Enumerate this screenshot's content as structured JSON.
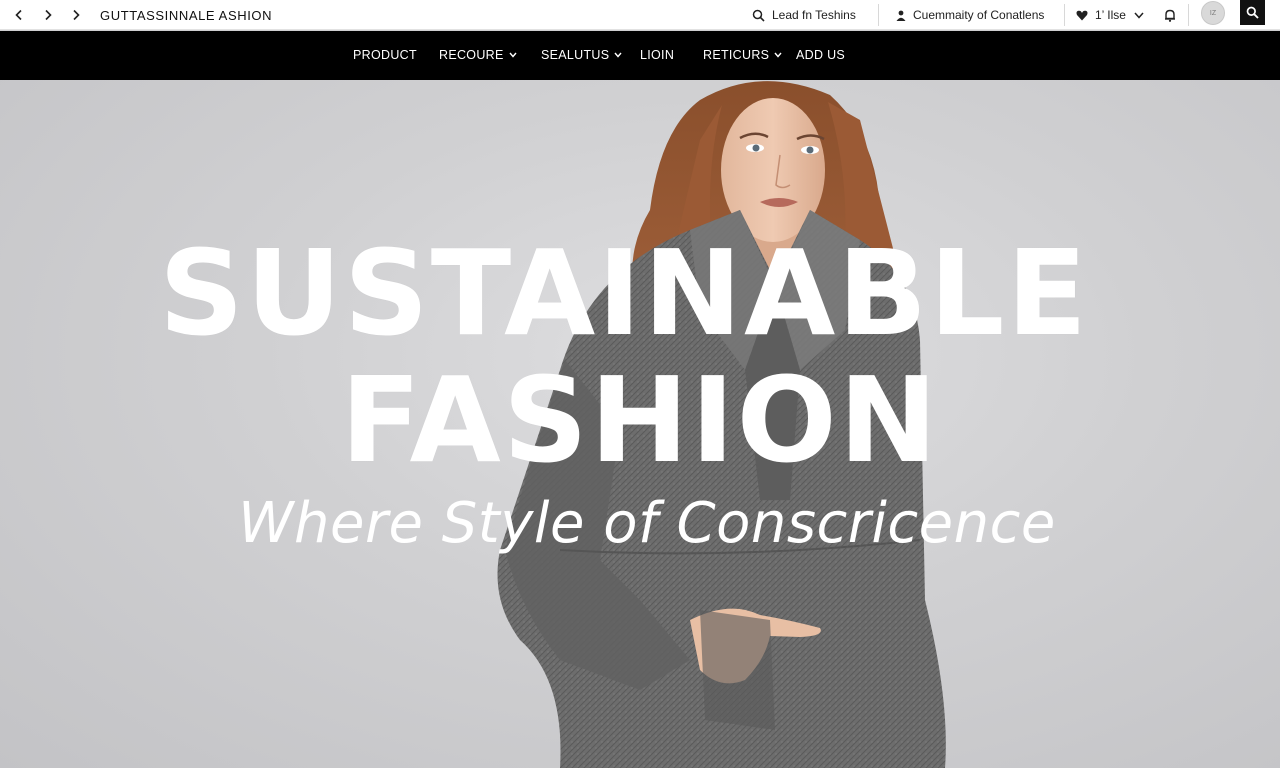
{
  "browser": {
    "site_title": "GUTTASSINNALE ASHION",
    "search_label": "Lead fn Teshins",
    "community_label": "Cuemmaity of Conatlens",
    "like_label": "1’ Ilse",
    "avatar_text": "IZ"
  },
  "nav": {
    "items": [
      {
        "label": "PRODUCT",
        "has_dropdown": false
      },
      {
        "label": "RECOURE",
        "has_dropdown": true
      },
      {
        "label": "SEALUTUS",
        "has_dropdown": true
      },
      {
        "label": "LIOIN",
        "has_dropdown": false
      },
      {
        "label": "RETICURS",
        "has_dropdown": true
      },
      {
        "label": "ADD US",
        "has_dropdown": false
      }
    ]
  },
  "hero": {
    "headline_line1": "SUSTAINABLE",
    "headline_line2": "FASHION",
    "tagline": "Where Style of Conscricence"
  },
  "icons": [
    "back-arrow-icon",
    "forward-arrow-icon",
    "search-icon",
    "user-icon",
    "heart-icon",
    "chevron-down-icon",
    "bell-icon"
  ],
  "colors": {
    "nav_background": "#000000",
    "hero_background": "#cfcfd1",
    "headline_text": "#ffffff",
    "coat": "#6b6b6b"
  }
}
